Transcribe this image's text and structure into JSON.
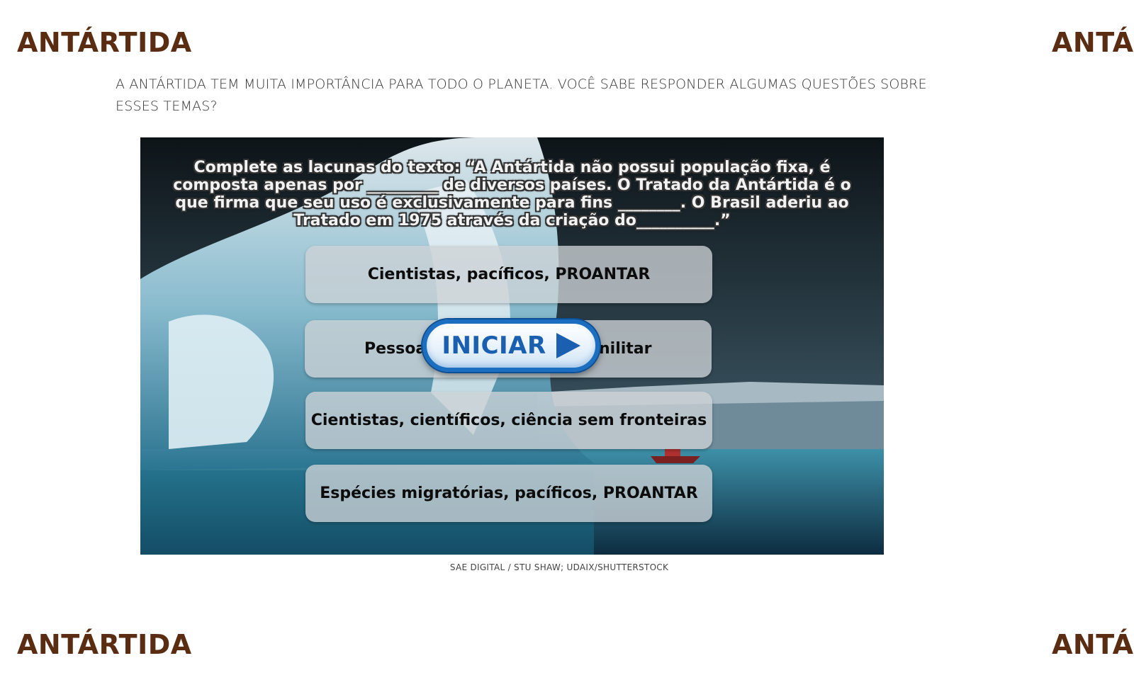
{
  "section": {
    "title": "ANTÁRTIDA",
    "title_partial": "ANTÁI"
  },
  "intro": "A ANTÁRTIDA TEM MUITA IMPORTÂNCIA PARA TODO O PLANETA. VOCÊ SABE RESPONDER ALGUMAS QUESTÕES SOBRE ESSES TEMAS?",
  "game": {
    "question": "Complete as lacunas do texto: “A Antártida não possui população fixa, é composta apenas por _________ de diversos países. O Tratado da Antártida é o que firma que seu uso é exclusivamente para fins ________. O Brasil aderiu ao Tratado em 1975 através da criação do__________.”",
    "options": [
      "Cientistas, pacíficos, PROANTAR",
      "Pessoas, militares, Programa Militar",
      "Cientistas, científicos, ciência sem fronteiras",
      "Espécies migratórias, pacíficos, PROANTAR"
    ],
    "option2_visible_left": "Pessoa",
    "option2_visible_right": "nilitar",
    "start_button": "INICIAR",
    "start_icon": "play-icon",
    "colors": {
      "button_blue": "#1a5fb0",
      "title_brown": "#5a2d12"
    }
  },
  "credit": "SAE DIGITAL / STU SHAW; UDAIX/SHUTTERSTOCK"
}
